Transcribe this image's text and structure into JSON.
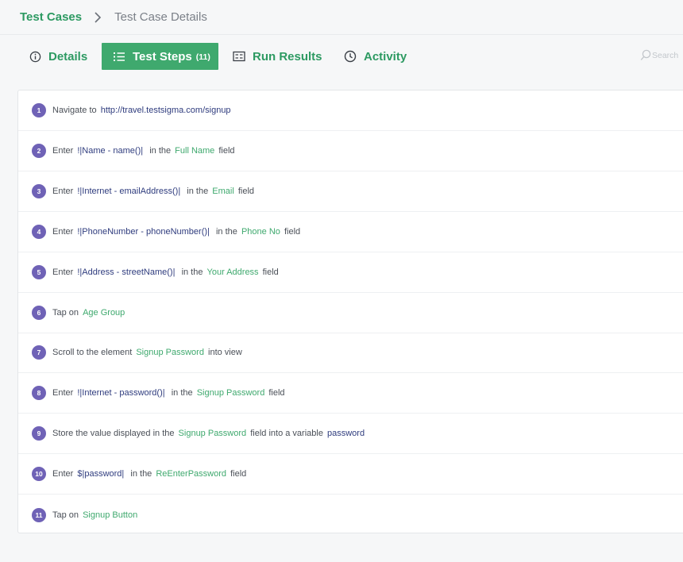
{
  "breadcrumb": {
    "root": "Test Cases",
    "current": "Test Case Details"
  },
  "tabs": {
    "details": "Details",
    "steps": "Test Steps",
    "steps_count": "(11)",
    "runs": "Run Results",
    "activity": "Activity"
  },
  "search": {
    "placeholder": "Search"
  },
  "colors": {
    "accent": "#3fa96e",
    "step_number": "#6f62b6",
    "test_data": "#2f3c7e"
  },
  "steps": [
    {
      "number": "1",
      "parts": [
        {
          "kind": "text",
          "value": "Navigate to "
        },
        {
          "kind": "url",
          "value": "http://travel.testsigma.com/signup"
        }
      ]
    },
    {
      "number": "2",
      "parts": [
        {
          "kind": "text",
          "value": "Enter "
        },
        {
          "kind": "data",
          "value": "!|Name - name()|"
        },
        {
          "kind": "text",
          "value": "  in the "
        },
        {
          "kind": "element",
          "value": "Full Name"
        },
        {
          "kind": "text",
          "value": " field"
        }
      ]
    },
    {
      "number": "3",
      "parts": [
        {
          "kind": "text",
          "value": "Enter "
        },
        {
          "kind": "data",
          "value": "!|Internet - emailAddress()|"
        },
        {
          "kind": "text",
          "value": "  in the "
        },
        {
          "kind": "element",
          "value": "Email"
        },
        {
          "kind": "text",
          "value": " field"
        }
      ]
    },
    {
      "number": "4",
      "parts": [
        {
          "kind": "text",
          "value": "Enter "
        },
        {
          "kind": "data",
          "value": "!|PhoneNumber - phoneNumber()|"
        },
        {
          "kind": "text",
          "value": "  in the "
        },
        {
          "kind": "element",
          "value": "Phone No"
        },
        {
          "kind": "text",
          "value": " field"
        }
      ]
    },
    {
      "number": "5",
      "parts": [
        {
          "kind": "text",
          "value": "Enter "
        },
        {
          "kind": "data",
          "value": "!|Address - streetName()|"
        },
        {
          "kind": "text",
          "value": "  in the "
        },
        {
          "kind": "element",
          "value": "Your Address"
        },
        {
          "kind": "text",
          "value": " field"
        }
      ]
    },
    {
      "number": "6",
      "parts": [
        {
          "kind": "text",
          "value": "Tap on "
        },
        {
          "kind": "element",
          "value": "Age Group"
        }
      ]
    },
    {
      "number": "7",
      "parts": [
        {
          "kind": "text",
          "value": "Scroll to the element "
        },
        {
          "kind": "element",
          "value": "Signup Password"
        },
        {
          "kind": "text",
          "value": " into view"
        }
      ]
    },
    {
      "number": "8",
      "parts": [
        {
          "kind": "text",
          "value": "Enter "
        },
        {
          "kind": "data",
          "value": "!|Internet - password()|"
        },
        {
          "kind": "text",
          "value": "  in the "
        },
        {
          "kind": "element",
          "value": "Signup Password"
        },
        {
          "kind": "text",
          "value": " field"
        }
      ]
    },
    {
      "number": "9",
      "parts": [
        {
          "kind": "text",
          "value": "Store the value displayed in the "
        },
        {
          "kind": "element",
          "value": "Signup Password"
        },
        {
          "kind": "text",
          "value": " field into a variable "
        },
        {
          "kind": "var",
          "value": "password"
        }
      ]
    },
    {
      "number": "10",
      "parts": [
        {
          "kind": "text",
          "value": "Enter "
        },
        {
          "kind": "data",
          "value": "$|password|"
        },
        {
          "kind": "text",
          "value": "  in the "
        },
        {
          "kind": "element",
          "value": "ReEnterPassword"
        },
        {
          "kind": "text",
          "value": " field"
        }
      ]
    },
    {
      "number": "11",
      "parts": [
        {
          "kind": "text",
          "value": "Tap on "
        },
        {
          "kind": "element",
          "value": "Signup Button"
        }
      ]
    }
  ]
}
